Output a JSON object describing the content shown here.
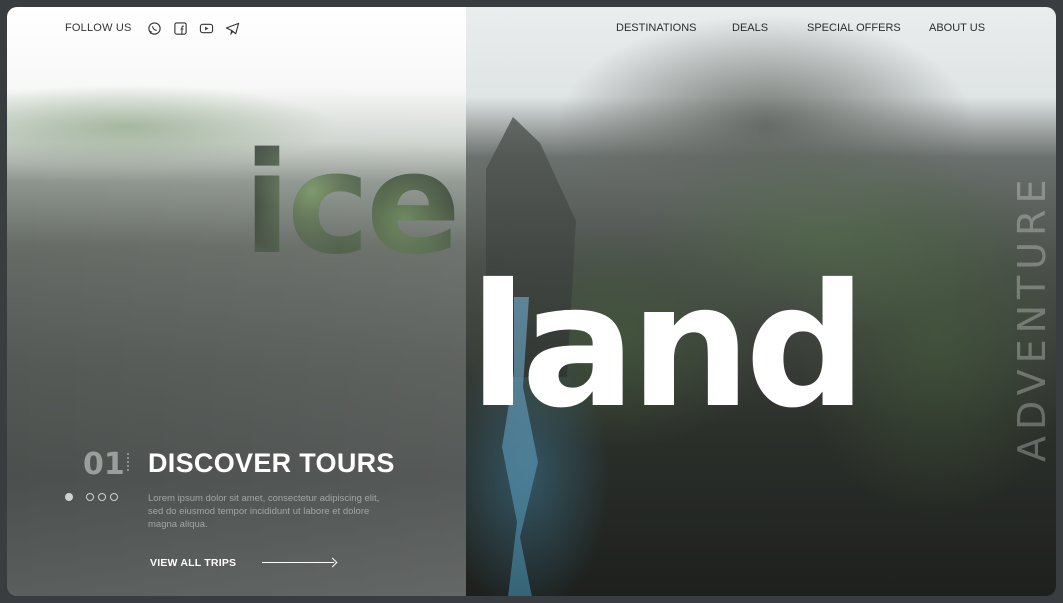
{
  "header": {
    "follow_label": "FOLLOW US",
    "social_icons": [
      "whatsapp-icon",
      "facebook-icon",
      "youtube-icon",
      "telegram-icon"
    ],
    "nav": [
      "DESTINATIONS",
      "DEALS",
      "SPECIAL OFFERS",
      "ABOUT US"
    ]
  },
  "hero": {
    "word_part1": "ice",
    "word_part2": "land",
    "vertical_text": "ADVENTURE"
  },
  "slide": {
    "number": "01",
    "title": "DISCOVER TOURS",
    "description": "Lorem ipsum dolor sit amet, consectetur adipiscing elit, sed do eiusmod tempor incididunt ut labore et dolore magna aliqua.",
    "cta_label": "VIEW ALL TRIPS",
    "dots_total": 4,
    "active_dot": 1
  },
  "colors": {
    "text_dark": "#333333",
    "title": "#ffffff",
    "muted": "#a2a6a4"
  }
}
